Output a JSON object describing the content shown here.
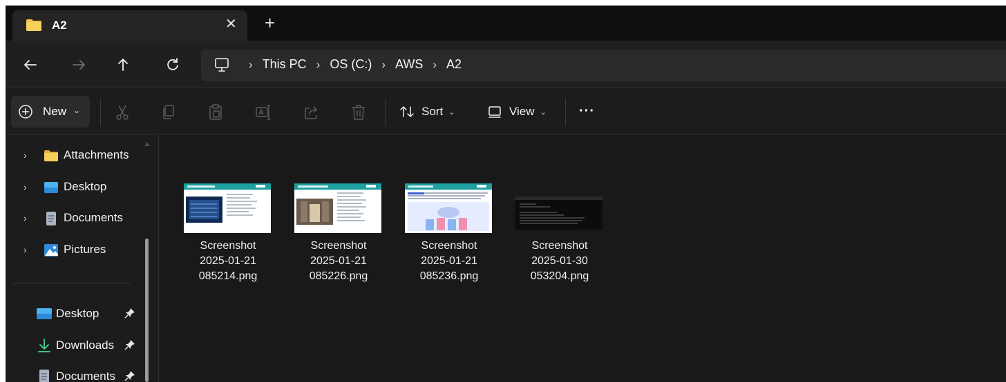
{
  "tab": {
    "title": "A2",
    "close_glyph": "✕",
    "add_glyph": "+"
  },
  "address": {
    "crumbs": [
      "This PC",
      "OS (C:)",
      "AWS",
      "A2"
    ],
    "separator": "›"
  },
  "toolbar": {
    "new_label": "New",
    "sort_label": "Sort",
    "view_label": "View",
    "more_glyph": "···",
    "chevron_glyph": "⌄"
  },
  "sidebar": {
    "tree": [
      {
        "label": "Attachments",
        "icon": "folder-icon"
      },
      {
        "label": "Desktop",
        "icon": "desktop-folder-icon"
      },
      {
        "label": "Documents",
        "icon": "documents-icon"
      },
      {
        "label": "Pictures",
        "icon": "pictures-icon"
      }
    ],
    "quick_access": [
      {
        "label": "Desktop",
        "icon": "desktop-folder-icon",
        "pinned": true
      },
      {
        "label": "Downloads",
        "icon": "download-icon",
        "pinned": true
      },
      {
        "label": "Documents",
        "icon": "documents-icon",
        "pinned": true
      }
    ]
  },
  "files": [
    {
      "name": "Screenshot\n2025-01-21\n085214.png",
      "thumb": "slide-thumbnail"
    },
    {
      "name": "Screenshot\n2025-01-21\n085226.png",
      "thumb": "slide-thumbnail"
    },
    {
      "name": "Screenshot\n2025-01-21\n085236.png",
      "thumb": "slide-thumbnail"
    },
    {
      "name": "Screenshot\n2025-01-30\n053204.png",
      "thumb": "terminal-thumbnail"
    }
  ],
  "colors": {
    "window_bg": "#1c1c1c",
    "folder_yellow": "#f2c04c",
    "accent_blue": "#3aa0e8"
  }
}
